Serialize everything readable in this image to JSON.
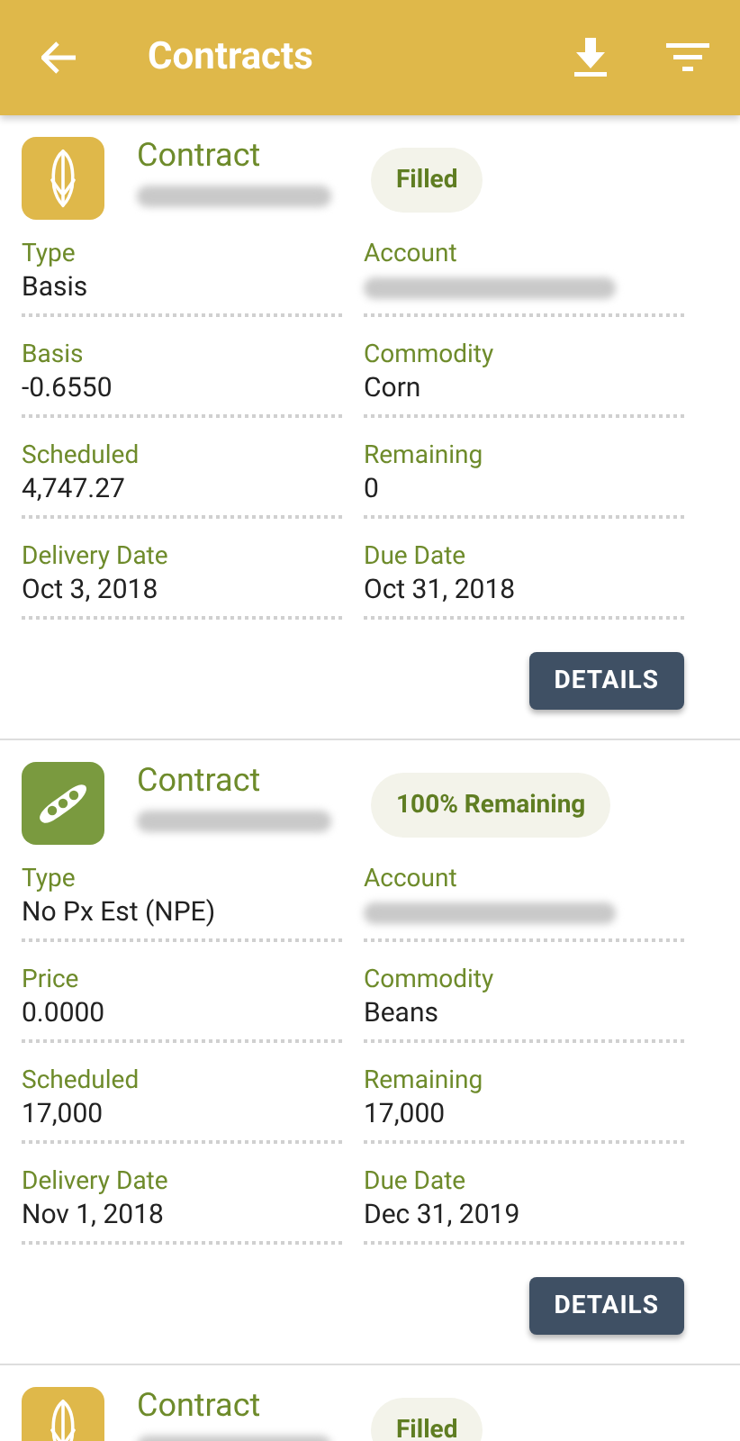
{
  "app_bar": {
    "title": "Contracts"
  },
  "contracts": [
    {
      "kind": "corn",
      "title": "Contract",
      "status": "Filled",
      "fields": [
        {
          "label": "Type",
          "value": "Basis",
          "kind": "text"
        },
        {
          "label": "Account",
          "kind": "redacted"
        },
        {
          "label": "Basis",
          "value": "-0.6550",
          "kind": "text"
        },
        {
          "label": "Commodity",
          "value": "Corn",
          "kind": "text"
        },
        {
          "label": "Scheduled",
          "value": "4,747.27",
          "kind": "text"
        },
        {
          "label": "Remaining",
          "value": "0",
          "kind": "text"
        },
        {
          "label": "Delivery Date",
          "value": "Oct 3, 2018",
          "kind": "text"
        },
        {
          "label": "Due Date",
          "value": "Oct 31, 2018",
          "kind": "text"
        }
      ],
      "action": "DETAILS"
    },
    {
      "kind": "bean",
      "title": "Contract",
      "status": "100% Remaining",
      "fields": [
        {
          "label": "Type",
          "value": "No Px Est (NPE)",
          "kind": "text"
        },
        {
          "label": "Account",
          "kind": "redacted"
        },
        {
          "label": "Price",
          "value": "0.0000",
          "kind": "text"
        },
        {
          "label": "Commodity",
          "value": "Beans",
          "kind": "text"
        },
        {
          "label": "Scheduled",
          "value": "17,000",
          "kind": "text"
        },
        {
          "label": "Remaining",
          "value": "17,000",
          "kind": "text"
        },
        {
          "label": "Delivery Date",
          "value": "Nov 1, 2018",
          "kind": "text"
        },
        {
          "label": "Due Date",
          "value": "Dec 31, 2019",
          "kind": "text"
        }
      ],
      "action": "DETAILS"
    },
    {
      "kind": "corn",
      "title": "Contract",
      "status": "Filled"
    }
  ]
}
